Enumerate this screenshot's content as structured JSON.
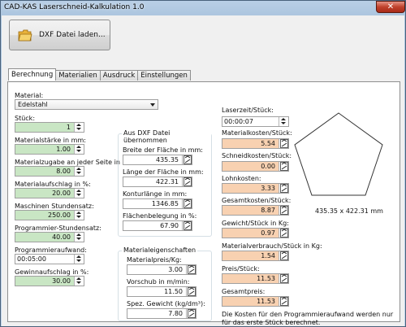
{
  "window": {
    "title": "CAD-KAS Laserschneid-Kalkulation 1.0",
    "close_glyph": "✕"
  },
  "toolbar": {
    "load_label": "DXF Datei laden..."
  },
  "tabs": [
    "Berechnung",
    "Materialien",
    "Ausdruck",
    "Einstellungen"
  ],
  "left": {
    "material_label": "Material:",
    "material_value": "Edelstahl",
    "stueck_label": "Stück:",
    "stueck_value": "1",
    "staerke_label": "Materialstärke in mm:",
    "staerke_value": "1.00",
    "zugabe_label": "Materialzugabe an jeder Seite in mm:",
    "zugabe_value": "8.00",
    "aufschlag_label": "Materialaufschlag in %:",
    "aufschlag_value": "20.00",
    "stundensatz_label": "Maschinen Stundensatz:",
    "stundensatz_value": "250.00",
    "prog_satz_label": "Programmier-Stundensatz:",
    "prog_satz_value": "40.00",
    "prog_aufwand_label": "Programmieraufwand:",
    "prog_aufwand_value": "00:05:00",
    "gewinn_label": "Gewinnaufschlag in %:",
    "gewinn_value": "30.00"
  },
  "dxf": {
    "group_title": "Aus DXF Datei übernommen",
    "breite_label": "Breite der Fläche in mm:",
    "breite_value": "435.35",
    "laenge_label": "Länge der Fläche in mm:",
    "laenge_value": "422.31",
    "kontur_label": "Konturlänge in mm:",
    "kontur_value": "1346.85",
    "belegung_label": "Flächenbelegung in %:",
    "belegung_value": "67.90"
  },
  "mat": {
    "group_title": "Materialeigenschaften",
    "preis_label": "Materialpreis/Kg:",
    "preis_value": "3.00",
    "vorschub_label": "Vorschub in m/min:",
    "vorschub_value": "11.50",
    "gewicht_label": "Spez. Gewicht (kg/dm³):",
    "gewicht_value": "7.80"
  },
  "right": {
    "laserzeit_label": "Laserzeit/Stück:",
    "laserzeit_value": "00:00:07",
    "matkosten_label": "Materialkosten/Stück:",
    "matkosten_value": "5.54",
    "schneid_label": "Schneidkosten/Stück:",
    "schneid_value": "0.00",
    "lohn_label": "Lohnkosten:",
    "lohn_value": "3.33",
    "gesamt_stueck_label": "Gesamtkosten/Stück:",
    "gesamt_stueck_value": "8.87",
    "gewicht_label": "Gewicht/Stück in Kg:",
    "gewicht_value": "0.97",
    "verbrauch_label": "Materialverbrauch/Stück in Kg:",
    "verbrauch_value": "1.54",
    "preis_label": "Preis/Stück:",
    "preis_value": "11.53",
    "gesamtpreis_label": "Gesamtpreis:",
    "gesamtpreis_value": "11.53",
    "note": "Die Kosten für den Programmieraufwand werden nur für das erste Stück berechnet."
  },
  "preview": {
    "dims": "435.35 x 422.31 mm"
  },
  "colors": {
    "green_field": "#c9e6c4",
    "orange_field": "#f8d1b1",
    "titlebar": "#a9c3dd"
  }
}
